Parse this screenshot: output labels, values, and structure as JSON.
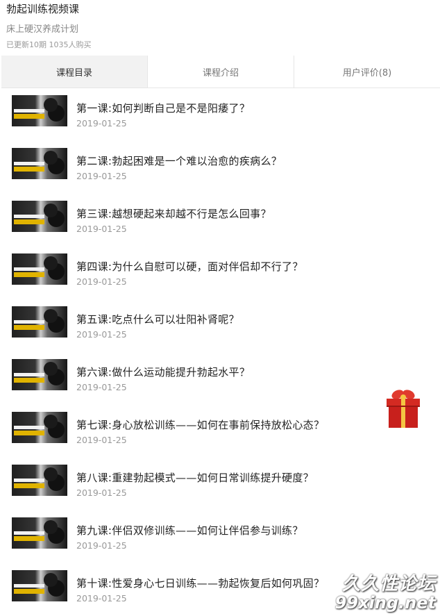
{
  "course": {
    "title": "勃起训练视频课",
    "subtitle": "床上硬汉养成计划",
    "meta": "已更新10期 1035人购买"
  },
  "tabs": [
    {
      "label": "课程目录",
      "active": true
    },
    {
      "label": "课程介绍",
      "active": false
    },
    {
      "label": "用户评价(8)",
      "active": false
    }
  ],
  "lessons": [
    {
      "title": "第一课:如何判断自己是不是阳痿了？",
      "date": "2019-01-25"
    },
    {
      "title": "第二课:勃起困难是一个难以治愈的疾病么？",
      "date": "2019-01-25"
    },
    {
      "title": "第三课:越想硬起来却越不行是怎么回事？",
      "date": "2019-01-25"
    },
    {
      "title": "第四课:为什么自慰可以硬，面对伴侣却不行了？",
      "date": "2019-01-25"
    },
    {
      "title": "第五课:吃点什么可以壮阳补肾呢？",
      "date": "2019-01-25"
    },
    {
      "title": "第六课:做什么运动能提升勃起水平？",
      "date": "2019-01-25"
    },
    {
      "title": "第七课:身心放松训练——如何在事前保持放松心态？",
      "date": "2019-01-25"
    },
    {
      "title": "第八课:重建勃起模式——如何日常训练提升硬度？",
      "date": "2019-01-25"
    },
    {
      "title": "第九课:伴侣双修训练——如何让伴侣参与训练？",
      "date": "2019-01-25"
    },
    {
      "title": "第十课:性爱身心七日训练——勃起恢复后如何巩固？",
      "date": "2019-01-25"
    }
  ],
  "gift_icon": "gift-box-icon",
  "watermark": {
    "line1": "久久性论坛",
    "line2": "99xing.net"
  },
  "colors": {
    "active_tab_bg": "#f2f2f2",
    "gift_red": "#c8201c",
    "thumb_accent": "#e0b300"
  }
}
